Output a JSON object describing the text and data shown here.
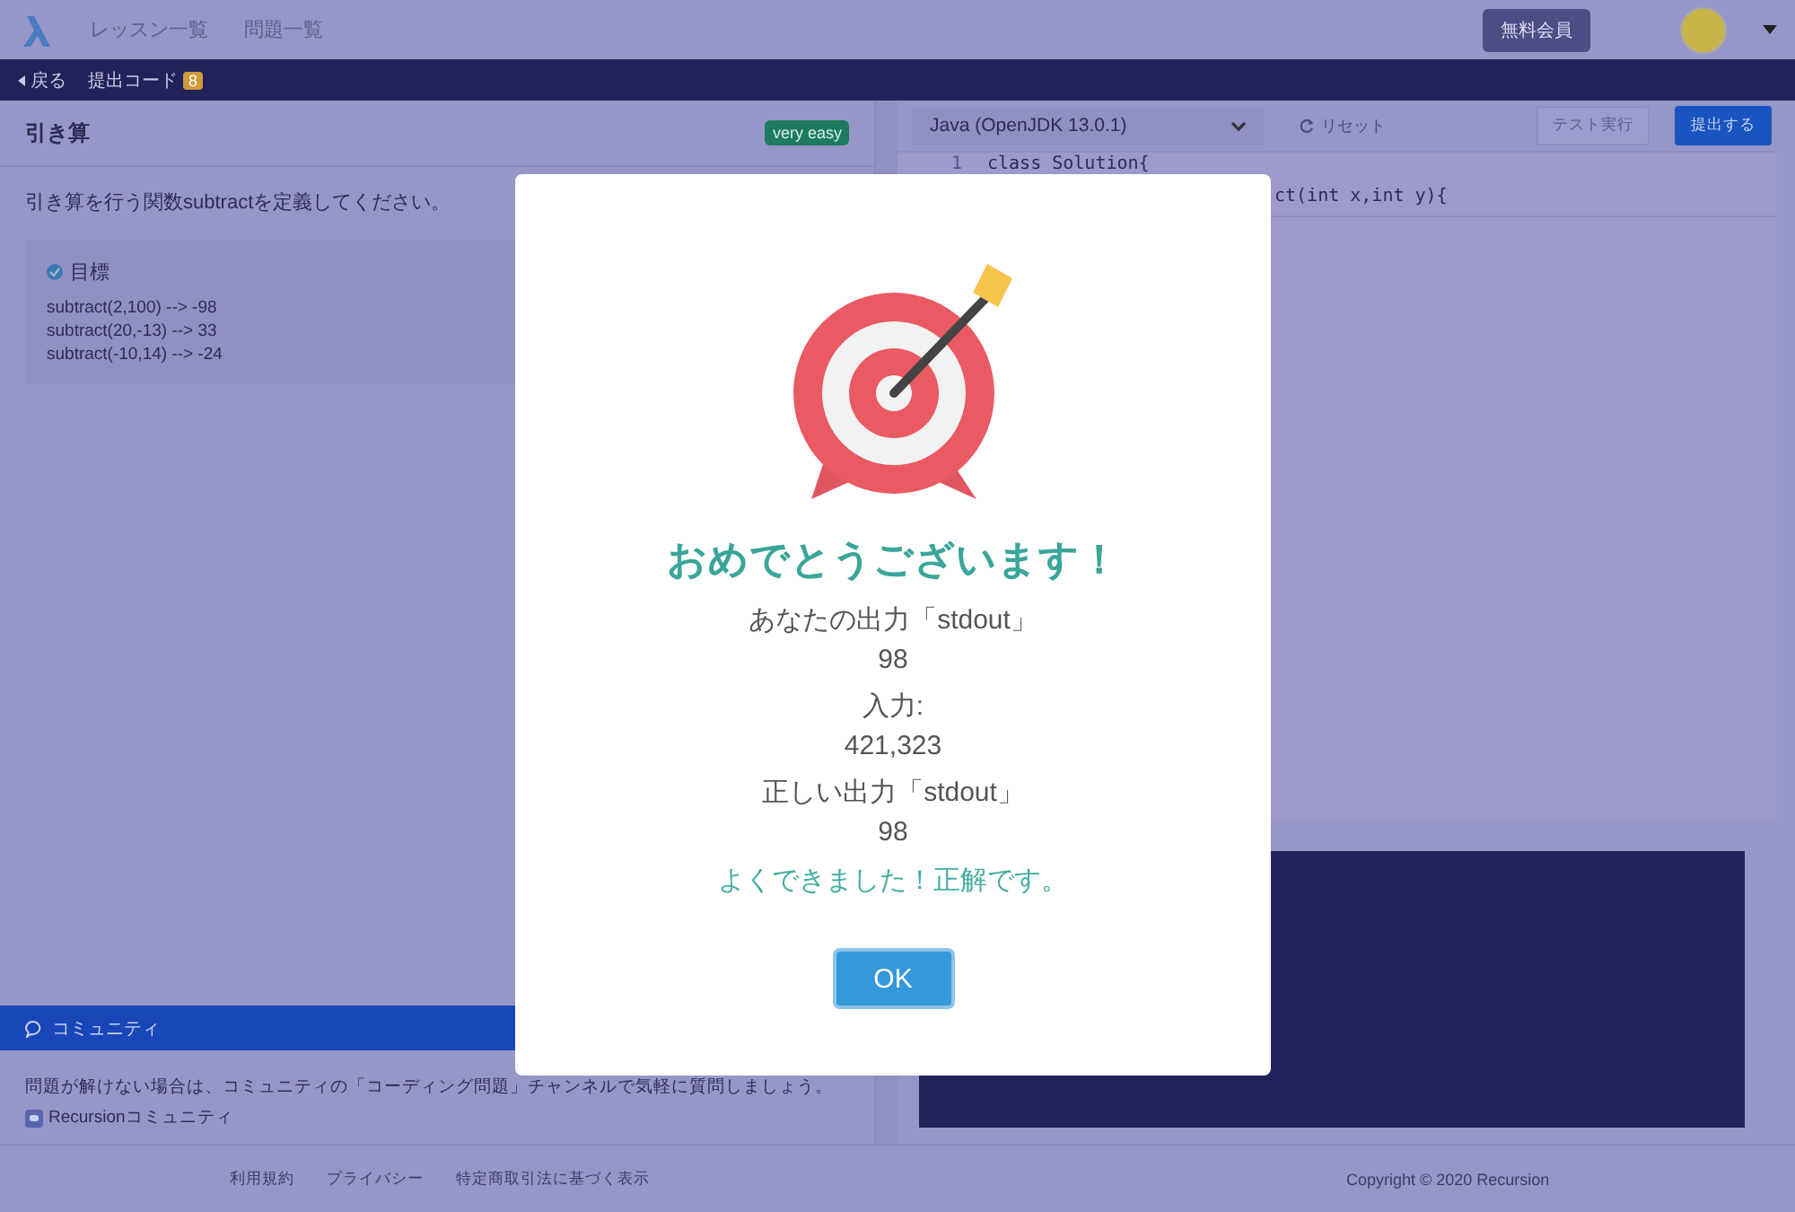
{
  "nav": {
    "items": [
      {
        "label": "レッスン一覧"
      },
      {
        "label": "問題一覧"
      }
    ],
    "member_button": "無料会員"
  },
  "subbar": {
    "back": "戻る",
    "submissions": {
      "label": "提出コード",
      "count": "8"
    }
  },
  "problem": {
    "title": "引き算",
    "difficulty": "very easy",
    "description": "引き算を行う関数subtractを定義してください。",
    "goal": {
      "title": "目標",
      "lines": [
        "subtract(2,100) --> -98",
        "subtract(20,-13) --> 33",
        "subtract(-10,14) --> -24"
      ]
    }
  },
  "community": {
    "title": "コミュニティ",
    "text": "問題が解けない場合は、コミュニティの「コーディング問題」チャンネルで気軽に質問しましょう。",
    "link": "Recursionコミュニティ"
  },
  "editor": {
    "language": "Java (OpenJDK 13.0.1)",
    "reset": "リセット",
    "test_run": "テスト実行",
    "submit": "提出する",
    "lines": [
      {
        "number": "1",
        "code": "class Solution{"
      },
      {
        "code": "ct(int x,int y){"
      }
    ]
  },
  "footer": {
    "links": [
      "利用規約",
      "プライバシー",
      "特定商取引法に基づく表示"
    ],
    "copyright": "Copyright © 2020 Recursion"
  },
  "modal": {
    "title": "おめでとうございます！",
    "items": [
      {
        "label": "あなたの出力「stdout」",
        "value": "98"
      },
      {
        "label": "入力:",
        "value": "421,323"
      },
      {
        "label": "正しい出力「stdout」",
        "value": "98"
      }
    ],
    "message": "よくできました！正解です。",
    "ok": "OK"
  }
}
